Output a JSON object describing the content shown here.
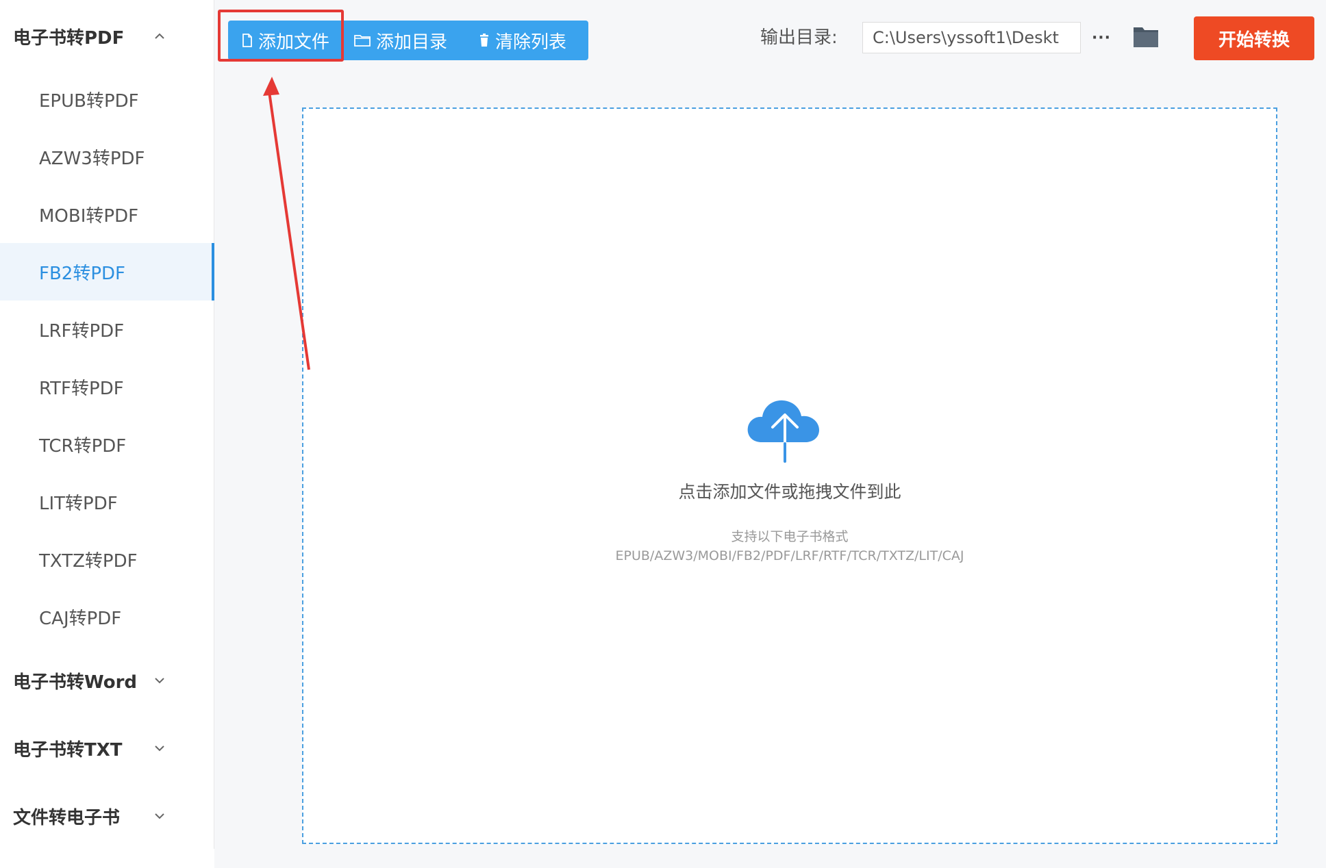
{
  "sidebar": {
    "groups": [
      {
        "label": "电子书转PDF",
        "expanded": true,
        "items": [
          {
            "label": "EPUB转PDF"
          },
          {
            "label": "AZW3转PDF"
          },
          {
            "label": "MOBI转PDF"
          },
          {
            "label": "FB2转PDF",
            "active": true
          },
          {
            "label": "LRF转PDF"
          },
          {
            "label": "RTF转PDF"
          },
          {
            "label": "TCR转PDF"
          },
          {
            "label": "LIT转PDF"
          },
          {
            "label": "TXTZ转PDF"
          },
          {
            "label": "CAJ转PDF"
          }
        ]
      },
      {
        "label": "电子书转Word",
        "expanded": false
      },
      {
        "label": "电子书转TXT",
        "expanded": false
      },
      {
        "label": "文件转电子书",
        "expanded": false
      }
    ]
  },
  "toolbar": {
    "add_file": "添加文件",
    "add_dir": "添加目录",
    "clear_list": "清除列表",
    "output_label": "输出目录:",
    "output_path": "C:\\Users\\yssoft1\\Deskt",
    "more": "···",
    "start": "开始转换",
    "accent_color": "#3aa3ee",
    "start_color": "#ee4a24",
    "folder_icon": "folder-icon"
  },
  "dropzone": {
    "main_text": "点击添加文件或拖拽文件到此",
    "sub_text": "支持以下电子书格式",
    "formats": "EPUB/AZW3/MOBI/FB2/PDF/LRF/RTF/TCR/TXTZ/LIT/CAJ",
    "icon": "cloud-upload-icon"
  },
  "annotation": {
    "highlight_color": "#e53935"
  }
}
